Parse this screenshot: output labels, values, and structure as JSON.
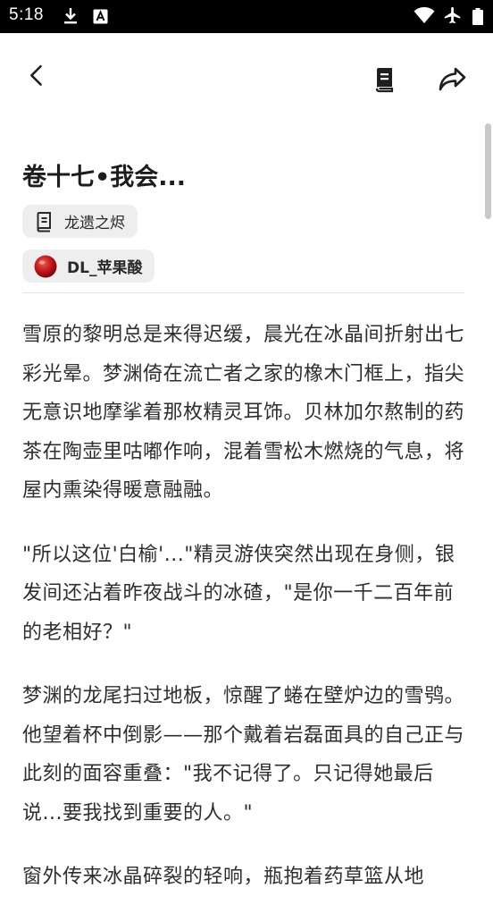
{
  "status_bar": {
    "time": "5:18",
    "icons": [
      "download-icon",
      "notification-a-icon",
      "wifi-icon",
      "airplane-icon"
    ]
  },
  "top_bar": {
    "icons": [
      "back-arrow-icon",
      "book-icon",
      "share-icon"
    ]
  },
  "article": {
    "title": "卷十七•我会...",
    "book_chip_label": "龙遗之烬",
    "author_chip_label": "DL_苹果酸",
    "paragraphs": [
      "雪原的黎明总是来得迟缓，晨光在冰晶间折射出七彩光晕。梦渊倚在流亡者之家的橡木门框上，指尖无意识地摩挲着那枚精灵耳饰。贝林加尔熬制的药茶在陶壶里咕嘟作响，混着雪松木燃烧的气息，将屋内熏染得暖意融融。",
      "\"所以这位'白榆'...\"精灵游侠突然出现在身侧，银发间还沾着昨夜战斗的冰碴，\"是你一千二百年前的老相好？\"",
      "梦渊的龙尾扫过地板，惊醒了蜷在壁炉边的雪鸮。他望着杯中倒影——那个戴着岩磊面具的自己正与此刻的面容重叠：\"我不记得了。只记得她最后说...要我找到重要的人。\"",
      "窗外传来冰晶碎裂的轻响，瓶抱着药草篮从地"
    ]
  },
  "colors": {
    "status_bar_bg": "#000000",
    "chip_bg": "#eeeeee",
    "text": "#2e2e2e",
    "author_avatar": "#c0141b"
  }
}
